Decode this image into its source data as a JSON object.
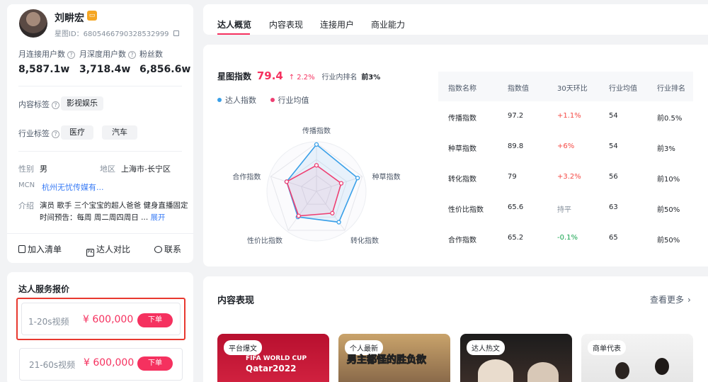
{
  "profile": {
    "name": "刘畊宏",
    "id_label": "星图ID：",
    "id_value": "6805466790328532999",
    "stats": [
      {
        "label": "月连接用户数",
        "value": "8,587.1w",
        "help": true
      },
      {
        "label": "月深度用户数",
        "value": "3,718.4w",
        "help": true
      },
      {
        "label": "粉丝数",
        "value": "6,856.6w",
        "help": false
      }
    ],
    "content_tags_label": "内容标签",
    "content_tags": [
      "影视娱乐"
    ],
    "industry_tags_label": "行业标签",
    "industry_tags": [
      "医疗",
      "汽车"
    ],
    "gender_label": "性别",
    "gender": "男",
    "region_label": "地区",
    "region": "上海市-长宁区",
    "mcn_label": "MCN",
    "mcn": "杭州无忧传媒有...",
    "intro_label": "介绍",
    "intro_line1": "演员 歌手 三个宝宝的超人爸爸 健身直播固定",
    "intro_line2": "时间预告：每周 周二周四周日 ...",
    "expand_label": "展开",
    "actions": {
      "add_list": "加入清单",
      "compare": "达人对比",
      "contact": "联系"
    }
  },
  "pricing": {
    "title": "达人服务报价",
    "items": [
      {
        "label": "1-20s视频",
        "price": "¥ 600,000",
        "button": "下单"
      },
      {
        "label": "21-60s视频",
        "price": "¥ 600,000",
        "button": "下单"
      }
    ]
  },
  "tabs": [
    "达人概览",
    "内容表现",
    "连接用户",
    "商业能力"
  ],
  "index_panel": {
    "title": "星图指数",
    "score": "79.4",
    "change": "↑ 2.2%",
    "rank_label": "行业内排名",
    "rank_value": "前3%",
    "legend": [
      "达人指数",
      "行业均值"
    ],
    "colors": {
      "talent": "#3aa0e8",
      "industry": "#ee3f72",
      "up": "#f54a45",
      "down": "#17a550"
    },
    "table_headers": [
      "指数名称",
      "指数值",
      "30天环比",
      "行业均值",
      "行业排名"
    ],
    "table_rows": [
      {
        "name": "传播指数",
        "value": "97.2",
        "change": "+1.1%",
        "trend": "up",
        "avg": "54",
        "rank": "前0.5%"
      },
      {
        "name": "种草指数",
        "value": "89.8",
        "change": "+6%",
        "trend": "up",
        "avg": "54",
        "rank": "前3%"
      },
      {
        "name": "转化指数",
        "value": "79",
        "change": "+3.2%",
        "trend": "up",
        "avg": "56",
        "rank": "前10%"
      },
      {
        "name": "性价比指数",
        "value": "65.6",
        "change": "持平",
        "trend": "flat",
        "avg": "63",
        "rank": "前50%"
      },
      {
        "name": "合作指数",
        "value": "65.2",
        "change": "-0.1%",
        "trend": "down",
        "avg": "65",
        "rank": "前50%"
      }
    ]
  },
  "chart_data": {
    "type": "radar",
    "categories": [
      "传播指数",
      "种草指数",
      "转化指数",
      "性价比指数",
      "合作指数"
    ],
    "max": 100,
    "series": [
      {
        "name": "达人指数",
        "values": [
          97.2,
          89.8,
          79,
          65.6,
          65.2
        ]
      },
      {
        "name": "行业均值",
        "values": [
          54,
          54,
          56,
          63,
          65
        ]
      }
    ]
  },
  "content": {
    "title": "内容表现",
    "more": "查看更多",
    "badges": [
      "平台爆文",
      "个人最新",
      "达人热文",
      "商单代表"
    ],
    "thumb2_text": "男主都怪的胜负欲",
    "thumb1_text1": "FIFA WORLD CUP",
    "thumb1_text2": "Qatar2022"
  }
}
